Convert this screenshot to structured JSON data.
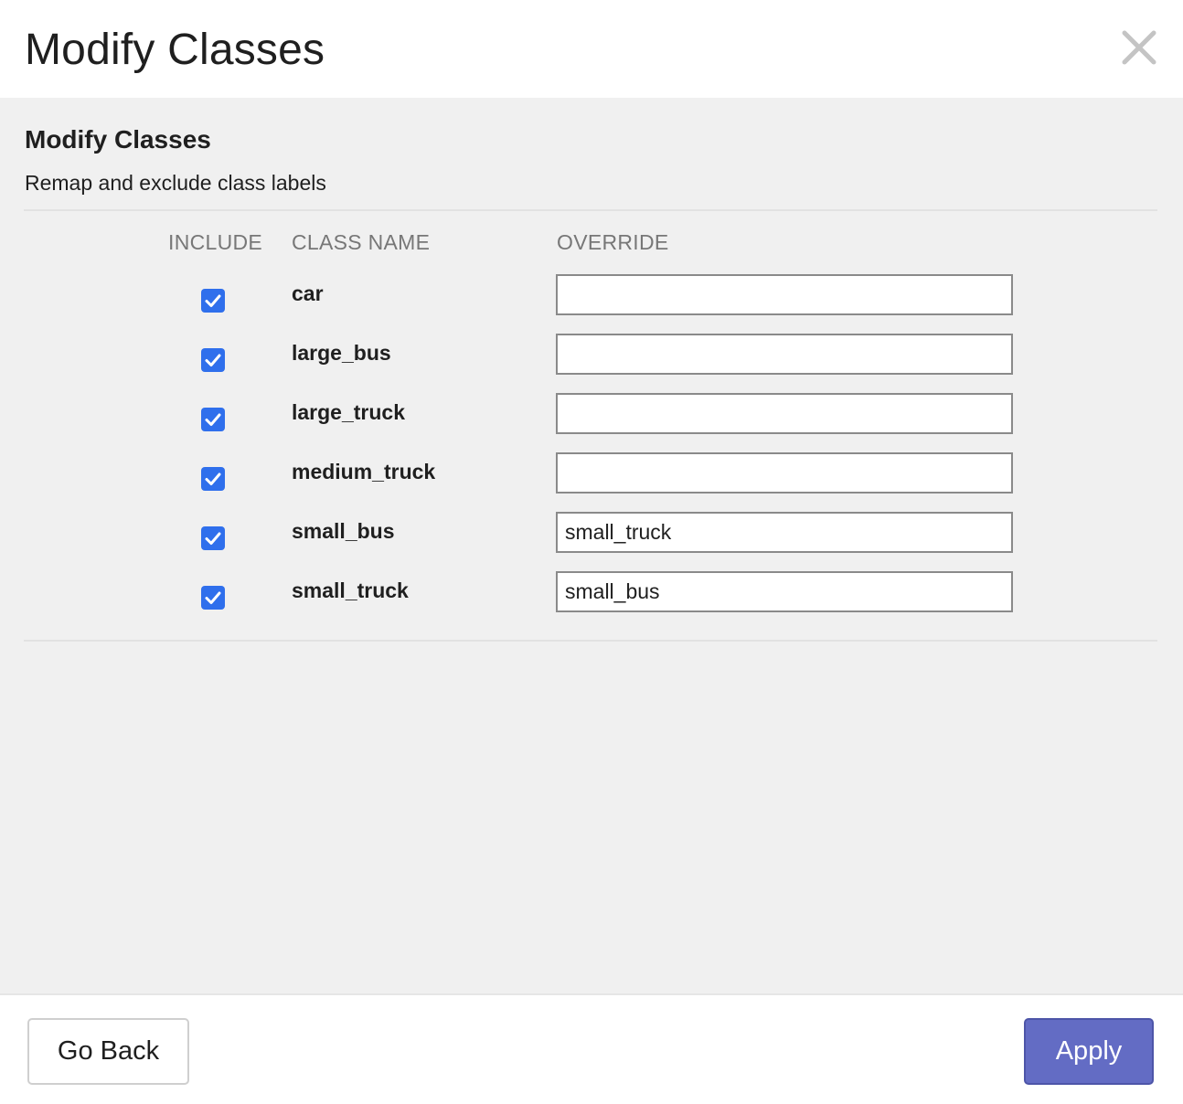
{
  "header": {
    "title": "Modify Classes",
    "close_icon": "close-icon"
  },
  "body": {
    "section_title": "Modify Classes",
    "section_subtitle": "Remap and exclude class labels",
    "columns": {
      "include": "INCLUDE",
      "class_name": "CLASS NAME",
      "override": "OVERRIDE"
    },
    "rows": [
      {
        "include": true,
        "class_name": "car",
        "override": ""
      },
      {
        "include": true,
        "class_name": "large_bus",
        "override": ""
      },
      {
        "include": true,
        "class_name": "large_truck",
        "override": ""
      },
      {
        "include": true,
        "class_name": "medium_truck",
        "override": ""
      },
      {
        "include": true,
        "class_name": "small_bus",
        "override": "small_truck"
      },
      {
        "include": true,
        "class_name": "small_truck",
        "override": "small_bus"
      }
    ]
  },
  "footer": {
    "go_back_label": "Go Back",
    "apply_label": "Apply"
  },
  "colors": {
    "checkbox": "#2f6fec",
    "apply_button": "#636cc4",
    "body_background": "#f0f0f0"
  }
}
